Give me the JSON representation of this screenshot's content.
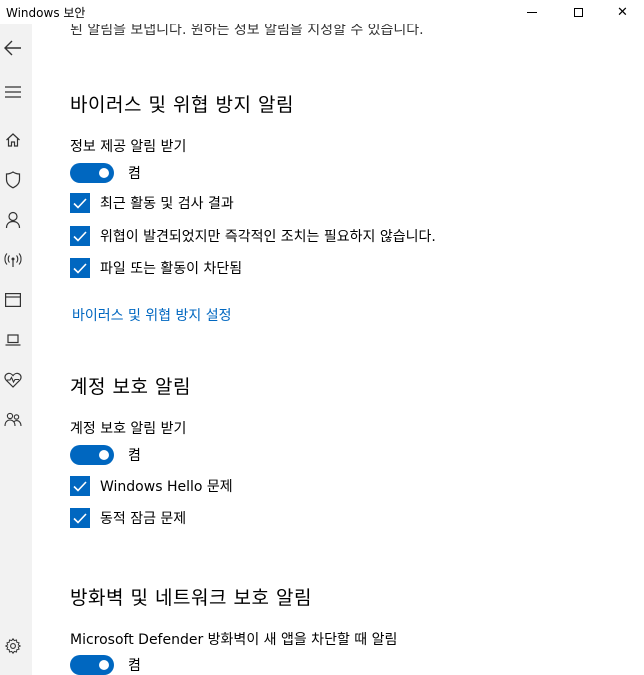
{
  "window": {
    "title": "Windows 보안",
    "minimize_icon": "minimize-icon",
    "maximize_icon": "maximize-icon",
    "close_icon": "close-icon",
    "close_glyph": "✕"
  },
  "sidebar": {
    "items": [
      {
        "icon": "back-arrow-icon"
      },
      {
        "icon": "hamburger-menu-icon"
      },
      {
        "icon": "home-icon"
      },
      {
        "icon": "shield-icon"
      },
      {
        "icon": "person-icon"
      },
      {
        "icon": "wireless-icon"
      },
      {
        "icon": "app-browser-icon"
      },
      {
        "icon": "laptop-icon"
      },
      {
        "icon": "heart-health-icon"
      },
      {
        "icon": "family-icon"
      },
      {
        "icon": "settings-gear-icon"
      }
    ]
  },
  "main": {
    "clipped_intro": "된 알림을 보냅니다. 원하는 정보 알림을 지정할 수 있습니다.",
    "virus": {
      "heading": "바이러스 및 위협 방지 알림",
      "sub_label": "정보 제공 알림 받기",
      "toggle_state": "켬",
      "checks": [
        "최근 활동 및 검사 결과",
        "위협이 발견되었지만 즉각적인 조치는 필요하지 않습니다.",
        "파일 또는 활동이 차단됨"
      ],
      "settings_link": "바이러스 및 위협 방지 설정"
    },
    "account": {
      "heading": "계정 보호 알림",
      "sub_label": "계정 보호 알림 받기",
      "toggle_state": "켬",
      "checks": [
        "Windows Hello 문제",
        "동적 잠금 문제"
      ]
    },
    "firewall": {
      "heading": "방화벽 및 네트워크 보호 알림",
      "sub_label": "Microsoft Defender 방화벽이 새 앱을 차단할 때 알림",
      "toggle_state": "켬"
    }
  },
  "colors": {
    "accent": "#0067c0",
    "sidebar_bg": "#f2f2f2"
  }
}
